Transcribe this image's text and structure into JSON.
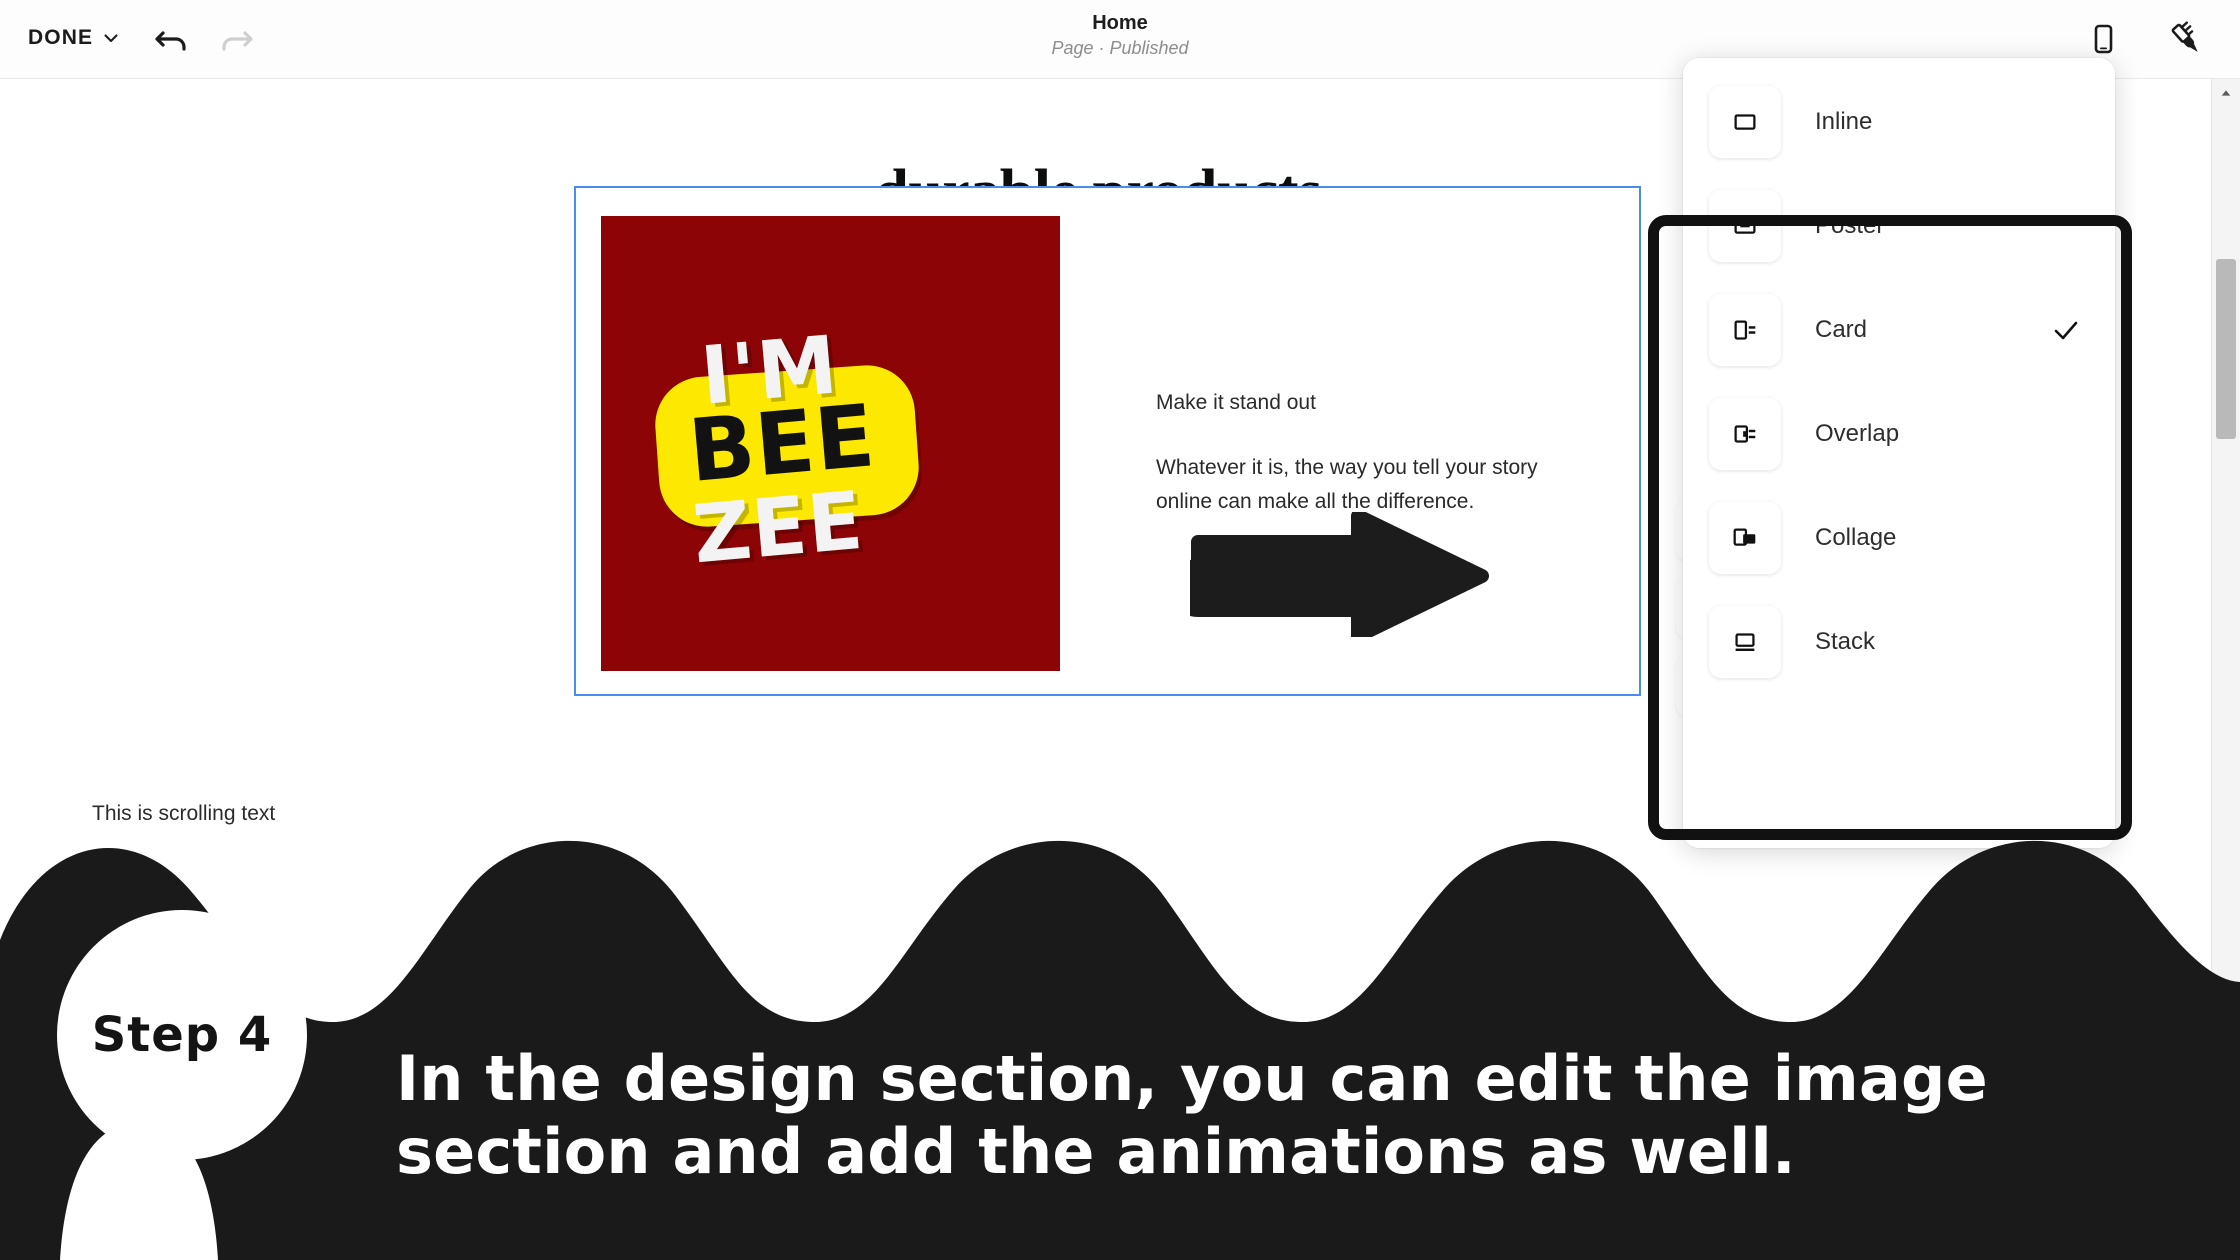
{
  "topbar": {
    "done_label": "DONE",
    "chevron_icon": "chevron-down-icon",
    "undo_icon": "undo-arrow-icon",
    "redo_icon": "redo-arrow-icon",
    "page_title": "Home",
    "page_status": "Page · Published",
    "mobile_icon": "mobile-device-icon",
    "brush_icon": "paintbrush-icon"
  },
  "canvas": {
    "hero_heading": "durable products.",
    "image": {
      "alt_name": "im-bee-zee-logo",
      "background_color": "#8c0405",
      "pill_color": "#fce800",
      "line1": "I'M",
      "line2": "BEE",
      "line3": "ZEE"
    },
    "block_text": {
      "heading": "Make it stand out",
      "body": "Whatever it is, the way you tell your story online can make all the difference."
    },
    "scrolling_text": "This is scrolling text",
    "selection_color": "#4a8cf0"
  },
  "annotation": {
    "arrow_icon": "right-arrow-annotation",
    "arrow_color": "#1c1c1c",
    "highlight_color": "#111111"
  },
  "dropdown": {
    "items": [
      {
        "label": "Inline",
        "icon": "layout-inline-icon",
        "checked": false
      },
      {
        "label": "Poster",
        "icon": "layout-poster-icon",
        "checked": false
      },
      {
        "label": "Card",
        "icon": "layout-card-icon",
        "checked": true
      },
      {
        "label": "Overlap",
        "icon": "layout-overlap-icon",
        "checked": false
      },
      {
        "label": "Collage",
        "icon": "layout-collage-icon",
        "checked": false
      },
      {
        "label": "Stack",
        "icon": "layout-stack-icon",
        "checked": false
      }
    ]
  },
  "scrollbar": {
    "up_arrow_icon": "scroll-up-arrow-icon"
  },
  "tutorial": {
    "step_label": "Step 4",
    "caption_line1": "In the design section, you can edit the image",
    "caption_line2": "section and add the animations as well.",
    "overlay_color": "#1a1a1a"
  }
}
